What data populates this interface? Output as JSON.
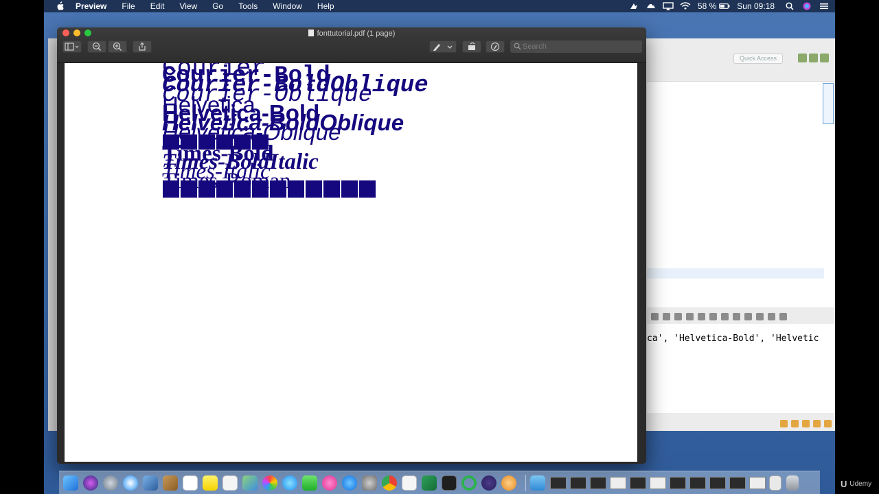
{
  "menubar": {
    "app": "Preview",
    "items": [
      "File",
      "Edit",
      "View",
      "Go",
      "Tools",
      "Window",
      "Help"
    ],
    "battery": "58 %",
    "clock": "Sun 09:18"
  },
  "window": {
    "title": "fonttutorial.pdf (1 page)",
    "search_placeholder": "Search"
  },
  "pdf_lines": {
    "courier": "Courier",
    "courier_bold": "Courier-Bold",
    "courier_bold_oblique": "Courier-BoldOblique",
    "courier_oblique": "Courier-Oblique",
    "helvetica": "Helvetica",
    "helvetica_bold": "Helvetica-Bold",
    "helvetica_bold_oblique": "Helvetica-BoldOblique",
    "helvetica_oblique": "Helvetica-Oblique",
    "times_bold": "Times-Bold",
    "times_bold_italic": "Times-BoldItalic",
    "times_italic": "Times-Italic",
    "times_roman": "Times-Roman"
  },
  "eclipse": {
    "quick_access": "Quick Access",
    "console_text": "ca', 'Helvetica-Bold', 'Helvetic"
  },
  "watermark": "Udemy",
  "colors": {
    "pdf_text": "#15077e",
    "menubar": "#1e3356",
    "desktop": "#4a76b4"
  }
}
